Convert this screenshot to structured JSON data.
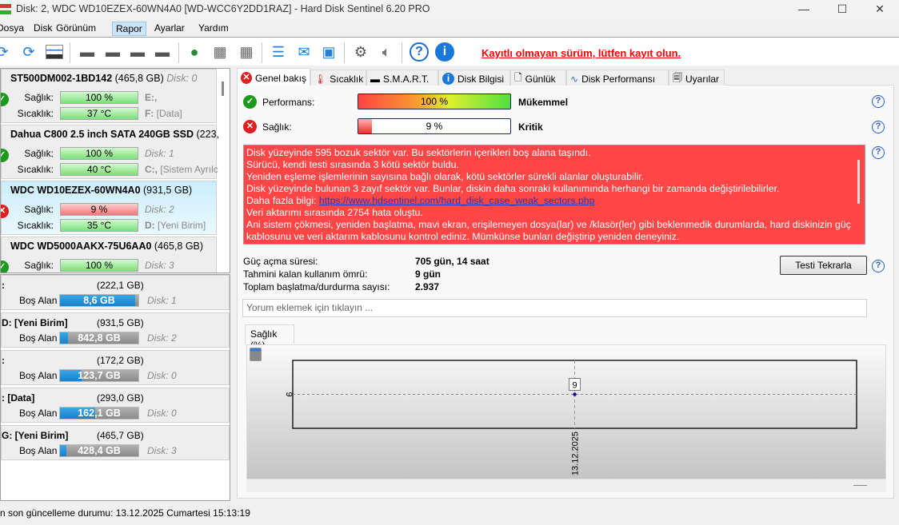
{
  "window": {
    "title": "Disk: 2, WDC WD10EZEX-60WN4A0 [WD-WCC6Y2DD1RAZ]  -  Hard Disk Sentinel 6.20 PRO",
    "minimize": "—",
    "maximize": "☐",
    "close": "✕"
  },
  "menu": [
    "Dosya",
    "Disk",
    "Görünüm",
    "Rapor",
    "Ayarlar",
    "Yardım"
  ],
  "menu_selected": "Rapor",
  "toolbar": {
    "icons": [
      "refresh-icon",
      "refresh-warning-icon",
      "disk-window-icon",
      "disk-sound-icon",
      "disk-clock-icon",
      "disk-check-icon",
      "disk-search-icon",
      "globe-disk-icon",
      "network-disk-icon",
      "network-disk-2-icon",
      "notepad-icon",
      "mail-icon",
      "network-computer-icon",
      "gear-icon",
      "speaker-icon",
      "help-icon",
      "info-icon"
    ],
    "register_link": "Kayıtlı olmayan sürüm, lütfen kayıt olun."
  },
  "disks": [
    {
      "name": "ST500DM002-1BD142",
      "size": "(465,8 GB)",
      "disk": "Disk: 0",
      "status": "ok",
      "health_label": "Sağlık:",
      "health": "100 %",
      "health_pct": 100,
      "temp_label": "Sıcaklık:",
      "temp": "37 °C",
      "vol1": "E:,",
      "vol2_letter": "F:",
      "vol2_name": "[Data]"
    },
    {
      "name": "Dahua C800 2.5 inch SATA 240GB SSD",
      "size": "(223,6 G",
      "disk": "Disk: 1",
      "status": "ok",
      "health_label": "Sağlık:",
      "health": "100 %",
      "health_pct": 100,
      "temp_label": "Sıcaklık:",
      "temp": "40 °C",
      "vol2_letter": "C:,",
      "vol2_name": " [Sistem Ayrılc"
    },
    {
      "name": "WDC WD10EZEX-60WN4A0",
      "size": "(931,5 GB)",
      "disk": "Disk: 2",
      "status": "bad",
      "health_label": "Sağlık:",
      "health": "9 %",
      "health_pct": 9,
      "temp_label": "Sıcaklık:",
      "temp": "35 °C",
      "vol2_letter": "D:",
      "vol2_name": "[Yeni Birim]"
    },
    {
      "name": "WDC WD5000AAKX-75U6AA0",
      "size": "(465,8 GB)",
      "disk": "Disk: 3",
      "status": "ok",
      "health_label": "Sağlık:",
      "health": "100 %",
      "health_pct": 100
    }
  ],
  "volumes": [
    {
      "name": ":",
      "size": "(222,1 GB)",
      "free_label": "Boş Alan",
      "free": "8,6 GB",
      "used_pct": 96,
      "disk": "Disk: 1"
    },
    {
      "name": "D: [Yeni Birim]",
      "size": "(931,5 GB)",
      "free_label": "Boş Alan",
      "free": "842,8 GB",
      "used_pct": 10,
      "disk": "Disk: 2"
    },
    {
      "name": ":",
      "size": "(172,2 GB)",
      "free_label": "Boş Alan",
      "free": "123,7 GB",
      "used_pct": 28,
      "disk": "Disk: 0"
    },
    {
      "name": ": [Data]",
      "size": "(293,0 GB)",
      "free_label": "Boş Alan",
      "free": "162,1 GB",
      "used_pct": 45,
      "disk": "Disk: 0"
    },
    {
      "name": "G: [Yeni Birim]",
      "size": "(465,7 GB)",
      "free_label": "Boş Alan",
      "free": "428,4 GB",
      "used_pct": 8,
      "disk": "Disk: 3"
    }
  ],
  "status_bar": "En son güncelleme durumu: 13.12.2025 Cumartesi 15:13:19",
  "tabs": [
    "Genel bakış",
    "Sıcaklık",
    "S.M.A.R.T.",
    "Disk Bilgisi",
    "Günlük",
    "Disk Performansı",
    "Uyarılar"
  ],
  "overview": {
    "performance_label": "Performans:",
    "performance": "100 %",
    "performance_pct": 100,
    "performance_rating": "Mükemmel",
    "health_label": "Sağlık:",
    "health": "9 %",
    "health_pct": 9,
    "health_rating": "Kritik",
    "messages": [
      "Disk yüzeyinde 595 bozuk sektör var. Bu sektörlerin içerikleri boş alana taşındı.",
      "Sürücü, kendi testi sırasında 3 kötü sektör buldu.",
      "Yeniden eşleme işlemlerinin sayısına bağlı olarak, kötü sektörler sürekli alanlar oluşturabilir.",
      "Disk yüzeyinde bulunan 3 zayıf sektör var. Bunlar, diskin daha sonraki kullanımında herhangi bir zamanda değiştirilebilirler."
    ],
    "more_info_label": "Daha fazla bilgi: ",
    "more_info_link": "https://www.hdsentinel.com/hard_disk_case_weak_sectors.php",
    "messages2": [
      "Veri aktarımı sırasında 2754 hata oluştu.",
      "Ani sistem çökmesi, yeniden başlatma, mavi ekran, erişilemeyen dosya(lar) ve /klasör(ler) gibi beklenmedik durumlarda, hard diskinizin güç kablosunu ve veri aktarım kablosunu kontrol ediniz. Mümkünse bunları değiştirip yeniden deneyiniz."
    ],
    "power_on_label": "Güç açma süresi:",
    "power_on": "705 gün, 14 saat",
    "remaining_label": "Tahmini kalan kullanım ömrü:",
    "remaining": "9 gün",
    "starts_label": "Toplam başlatma/durdurma sayısı:",
    "starts": "2.937",
    "retest_button": "Testi Tekrarla",
    "comment_placeholder": "Yorum eklemek için tıklayın ..."
  },
  "chart_data": {
    "type": "line",
    "tab_label": "Sağlık (%)",
    "x": [
      "13.12.2025"
    ],
    "y": [
      9
    ],
    "y_ticks": [
      "9"
    ],
    "data_labels": [
      "9"
    ],
    "grid": true,
    "point_color": "#00008b"
  }
}
